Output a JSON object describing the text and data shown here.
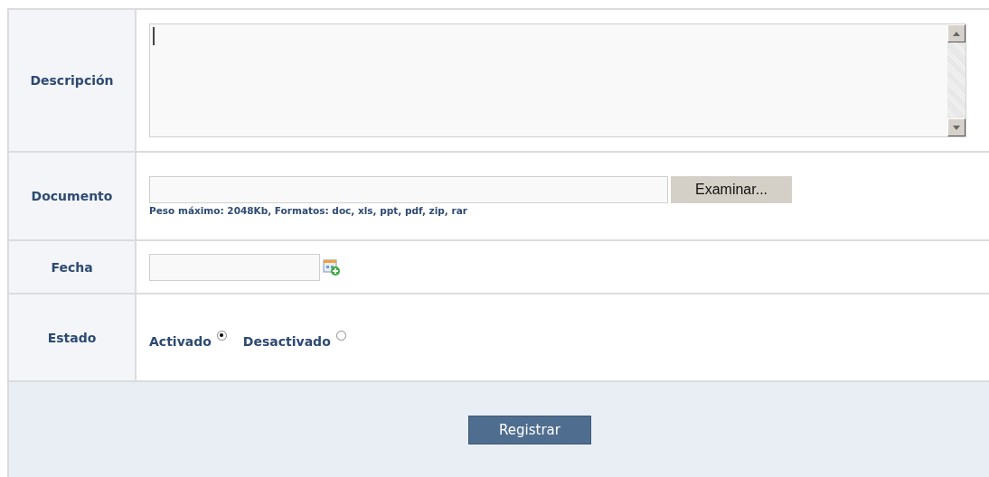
{
  "rows": [
    {
      "kind": "textarea",
      "label": "Descripción"
    },
    {
      "kind": "file",
      "label": "Documento",
      "button": "Examinar...",
      "hint": "Peso máximo: 2048Kb, Formatos: doc, xls, ppt, pdf, zip, rar"
    },
    {
      "kind": "date",
      "label": "Fecha"
    },
    {
      "kind": "radio",
      "label": "Estado",
      "options": [
        {
          "label": "Activado",
          "selected": true
        },
        {
          "label": "Desactivado",
          "selected": false
        }
      ]
    }
  ],
  "submit": "Registrar"
}
